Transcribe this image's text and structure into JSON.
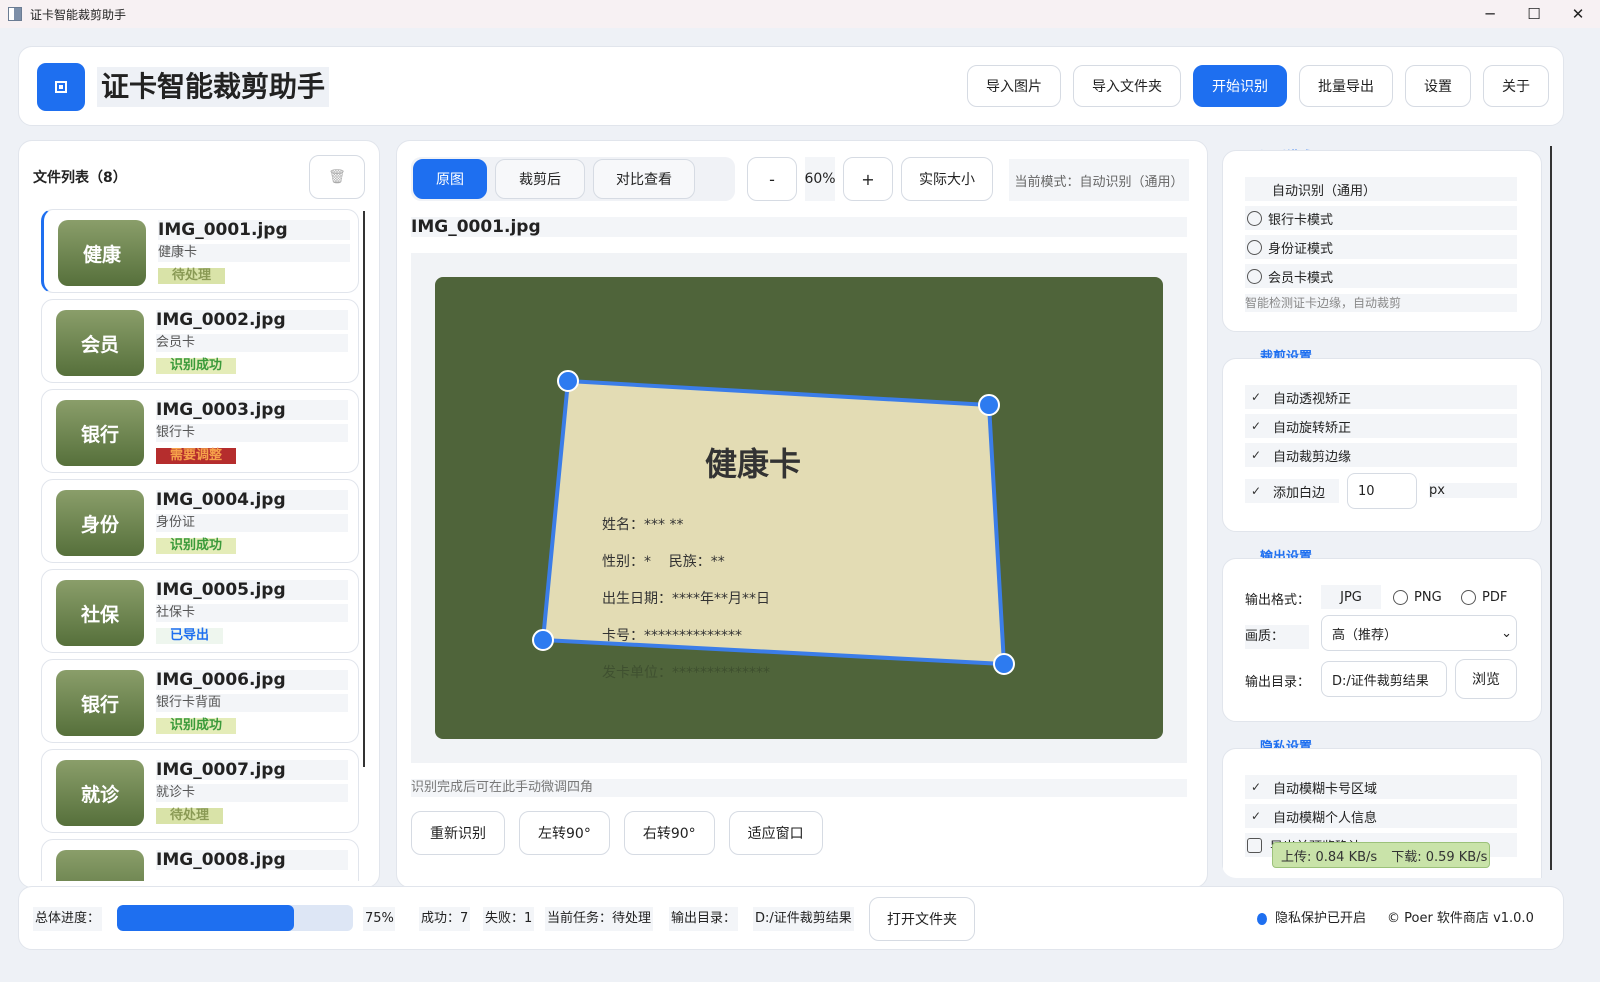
{
  "window": {
    "title": "证卡智能裁剪助手"
  },
  "header": {
    "title": "证卡智能裁剪助手",
    "buttons": {
      "import_image": "导入图片",
      "import_folder": "导入文件夹",
      "start": "开始识别",
      "batch_export": "批量导出",
      "settings": "设置",
      "about": "关于"
    }
  },
  "filelist": {
    "title": "文件列表（8）",
    "items": [
      {
        "thumb": "健康",
        "name": "IMG_0001.jpg",
        "type": "健康卡",
        "status": "待处理"
      },
      {
        "thumb": "会员",
        "name": "IMG_0002.jpg",
        "type": "会员卡",
        "status": "识别成功"
      },
      {
        "thumb": "银行",
        "name": "IMG_0003.jpg",
        "type": "银行卡",
        "status": "需要调整"
      },
      {
        "thumb": "身份",
        "name": "IMG_0004.jpg",
        "type": "身份证",
        "status": "识别成功"
      },
      {
        "thumb": "社保",
        "name": "IMG_0005.jpg",
        "type": "社保卡",
        "status": "已导出"
      },
      {
        "thumb": "银行",
        "name": "IMG_0006.jpg",
        "type": "银行卡背面",
        "status": "识别成功"
      },
      {
        "thumb": "就诊",
        "name": "IMG_0007.jpg",
        "type": "就诊卡",
        "status": "待处理"
      },
      {
        "thumb": "",
        "name": "IMG_0008.jpg",
        "type": "",
        "status": ""
      }
    ]
  },
  "viewer": {
    "tabs": [
      "原图",
      "裁剪后",
      "对比查看"
    ],
    "zoom_out": "-",
    "zoom_value": "60%",
    "zoom_in": "+",
    "actual_size": "实际大小",
    "mode_label": "当前模式：自动识别（通用）",
    "current_file": "IMG_0001.jpg",
    "card": {
      "title": "健康卡",
      "name": "姓名：*** **",
      "gender": "性别：*    民族：**",
      "birth": "出生日期：****年**月**日",
      "number": "卡号：**************",
      "issuer": "发卡单位：**************"
    },
    "hint": "识别完成后可在此手动微调四角",
    "actions": [
      "重新识别",
      "左转90°",
      "右转90°",
      "适应窗口"
    ]
  },
  "settings": {
    "recognition": {
      "title": "识别模式",
      "options": [
        "自动识别（通用）",
        "银行卡模式",
        "身份证模式",
        "会员卡模式"
      ],
      "note": "智能检测证卡边缘，自动裁剪"
    },
    "crop": {
      "title": "裁剪设置",
      "options": [
        "自动透视矫正",
        "自动旋转矫正",
        "自动裁剪边缘"
      ],
      "margin_label": "添加白边",
      "margin_value": "10",
      "margin_unit": "px"
    },
    "output": {
      "title": "输出设置",
      "format_label": "输出格式：",
      "formats": [
        "JPG",
        "PNG",
        "PDF"
      ],
      "quality_label": "画质：",
      "quality_value": "高（推荐）",
      "dir_label": "输出目录：",
      "dir_value": "D:/证件裁剪结果",
      "browse": "浏览"
    },
    "privacy": {
      "title": "隐私设置",
      "options": [
        "自动模糊卡号区域",
        "自动模糊个人信息",
        "导出前预览确认"
      ]
    }
  },
  "footer": {
    "progress_label": "总体进度：",
    "progress": 0.75,
    "progress_text": "75%",
    "success": "成功：7",
    "fail": "失败：1",
    "task": "当前任务：待处理",
    "outdir_label": "输出目录：",
    "outdir": "D:/证件裁剪结果",
    "open_folder": "打开文件夹",
    "privacy": "隐私保护已开启",
    "copyright": "© Poer 软件商店 v1.0.0"
  },
  "network": {
    "upload": "上传: 0.84 KB/s",
    "download": "下载: 0.59 KB/s"
  }
}
